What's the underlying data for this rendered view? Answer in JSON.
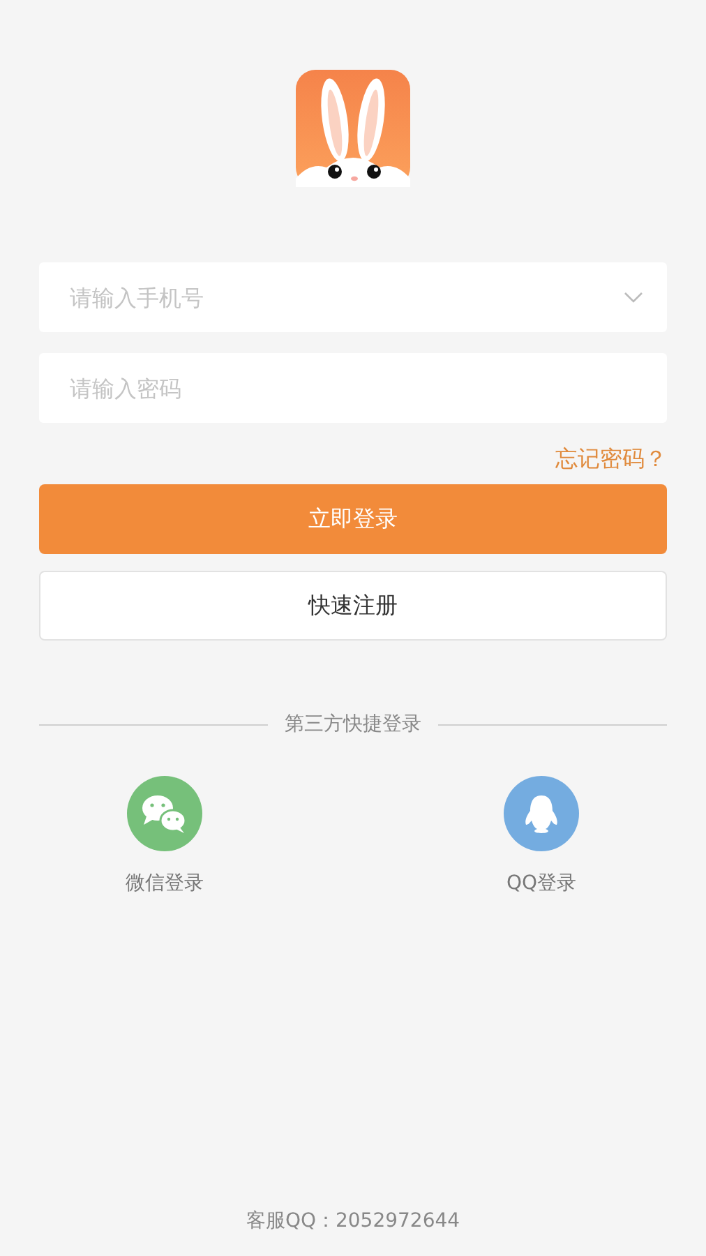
{
  "phone_field": {
    "placeholder": "请输入手机号"
  },
  "password_field": {
    "placeholder": "请输入密码"
  },
  "forgot_link": "忘记密码？",
  "login_button": "立即登录",
  "register_button": "快速注册",
  "third_party": {
    "title": "第三方快捷登录",
    "options": [
      {
        "kind": "wechat",
        "label": "微信登录"
      },
      {
        "kind": "qq",
        "label": "QQ登录"
      }
    ]
  },
  "footer": "客服QQ：2052972644"
}
